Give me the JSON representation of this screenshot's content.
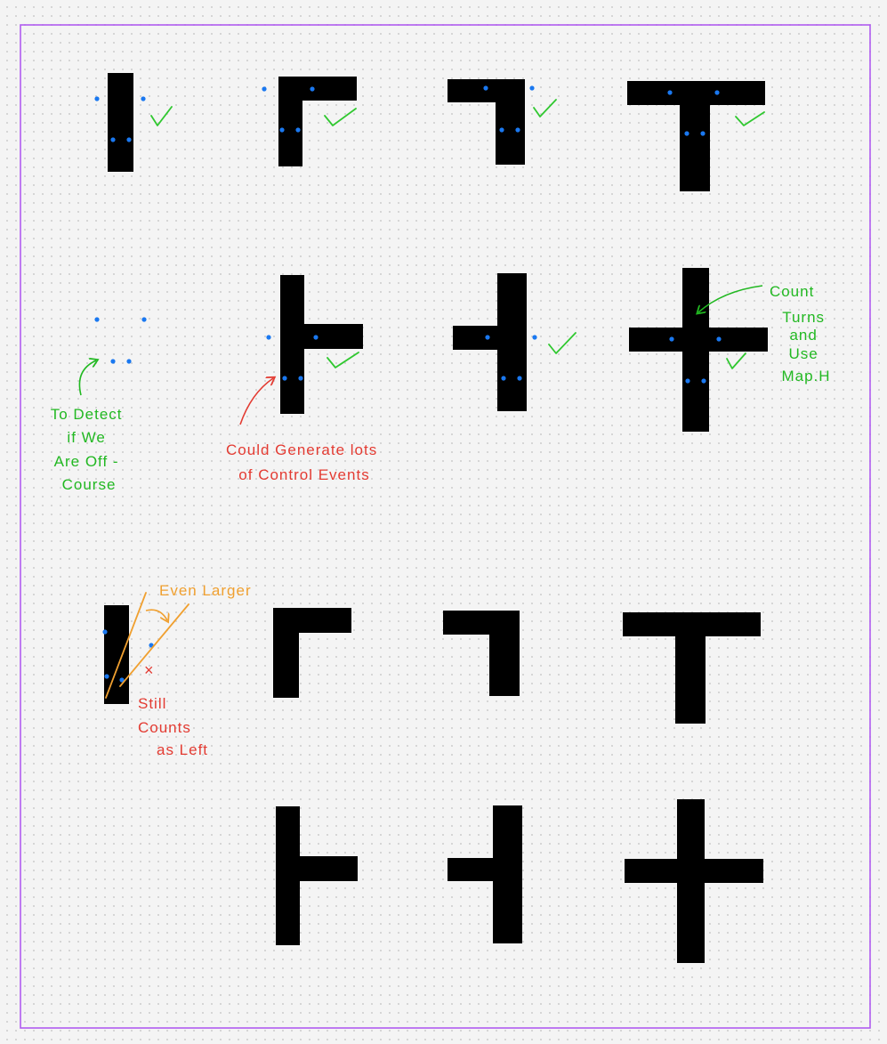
{
  "colors": {
    "page_border": "#b05cf0",
    "track": "#000000",
    "sensor": "#1a78f0",
    "check": "#30c830",
    "green_note": "#22b822",
    "red_note": "#e33b32",
    "orange_note": "#f0a030"
  },
  "notes": {
    "off_course": [
      "To Detect",
      "if We",
      "Are Off -",
      "Course"
    ],
    "control_events": [
      "Could Generate lots",
      "of Control Events"
    ],
    "count_turns": [
      "Count",
      "Turns",
      "and",
      "Use",
      "Map.H"
    ],
    "even_larger": "Even Larger",
    "still_counts": [
      "Still",
      "Counts",
      "as Left"
    ],
    "x_mark": "×"
  },
  "icons": [
    "check-icon",
    "sensor-dot-icon",
    "arrow-icon"
  ]
}
